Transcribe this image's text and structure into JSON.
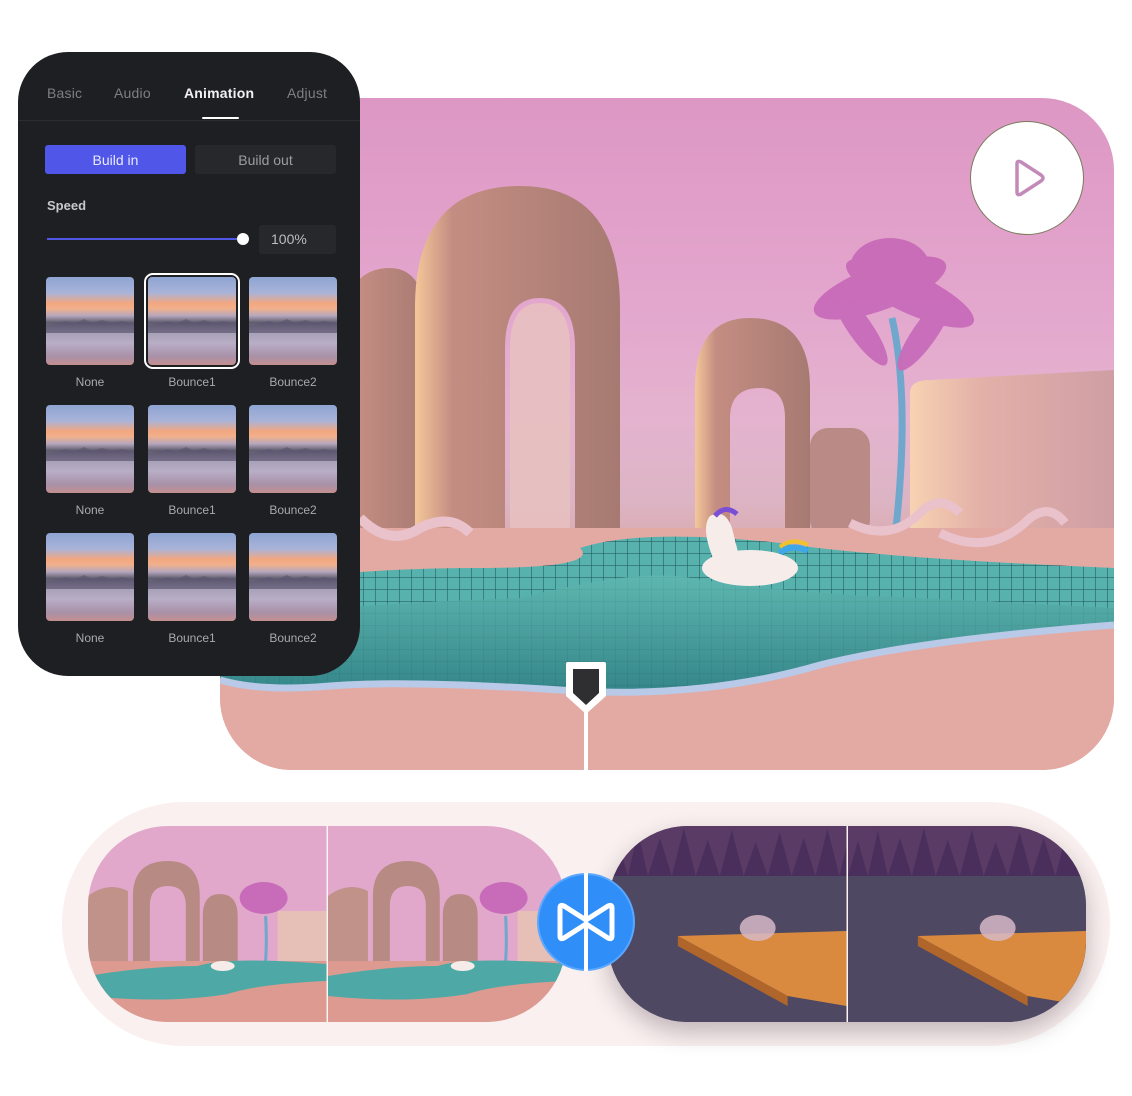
{
  "panel": {
    "tabs": [
      {
        "label": "Basic",
        "active": false
      },
      {
        "label": "Audio",
        "active": false
      },
      {
        "label": "Animation",
        "active": true
      },
      {
        "label": "Adjust",
        "active": false
      }
    ],
    "build_in_label": "Build in",
    "build_out_label": "Build out",
    "active_build": "Build in",
    "speed_label": "Speed",
    "speed_value": "100%",
    "speed_fraction": 1.0,
    "accent_color": "#4f56e8",
    "animations": [
      {
        "label": "None",
        "selected": false
      },
      {
        "label": "Bounce1",
        "selected": true
      },
      {
        "label": "Bounce2",
        "selected": false
      },
      {
        "label": "None",
        "selected": false
      },
      {
        "label": "Bounce1",
        "selected": false
      },
      {
        "label": "Bounce2",
        "selected": false
      },
      {
        "label": "None",
        "selected": false
      },
      {
        "label": "Bounce1",
        "selected": false
      },
      {
        "label": "Bounce2",
        "selected": false
      }
    ]
  },
  "preview": {
    "scene": "pink-arches-pool-with-unicorn-float",
    "play_icon": "play-icon"
  },
  "timeline": {
    "clips": [
      {
        "scene": "pink-arches-pool",
        "frames": 2
      },
      {
        "scene": "lake-dock-forest",
        "frames": 2
      }
    ],
    "transition_icon": "bowtie-transition-icon",
    "transition_color": "#2f8ef8",
    "playhead_icon": "playhead-marker-icon"
  }
}
